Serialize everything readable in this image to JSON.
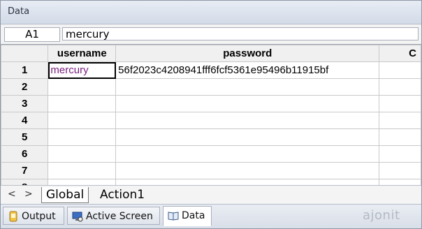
{
  "window": {
    "title": "Data"
  },
  "formula_bar": {
    "cell_ref": "A1",
    "cell_value": "mercury"
  },
  "grid": {
    "columns": [
      "username",
      "password",
      "C"
    ],
    "rows": [
      {
        "num": "1",
        "cells": [
          "mercury",
          "56f2023c4208941fff6fcf5361e95496b11915bf",
          ""
        ]
      },
      {
        "num": "2",
        "cells": [
          "",
          "",
          ""
        ]
      },
      {
        "num": "3",
        "cells": [
          "",
          "",
          ""
        ]
      },
      {
        "num": "4",
        "cells": [
          "",
          "",
          ""
        ]
      },
      {
        "num": "5",
        "cells": [
          "",
          "",
          ""
        ]
      },
      {
        "num": "6",
        "cells": [
          "",
          "",
          ""
        ]
      },
      {
        "num": "7",
        "cells": [
          "",
          "",
          ""
        ]
      },
      {
        "num": "8",
        "cells": [
          "",
          "",
          ""
        ]
      }
    ]
  },
  "sheet_tabs": {
    "prev": "<",
    "next": ">",
    "tabs": [
      "Global",
      "Action1"
    ]
  },
  "bottom_tabs": [
    "Output",
    "Active Screen",
    "Data"
  ],
  "branding": {
    "logo": "ajonit"
  },
  "colors": {
    "link_text": "#7a2180",
    "accent_border": "#8e98a8"
  }
}
